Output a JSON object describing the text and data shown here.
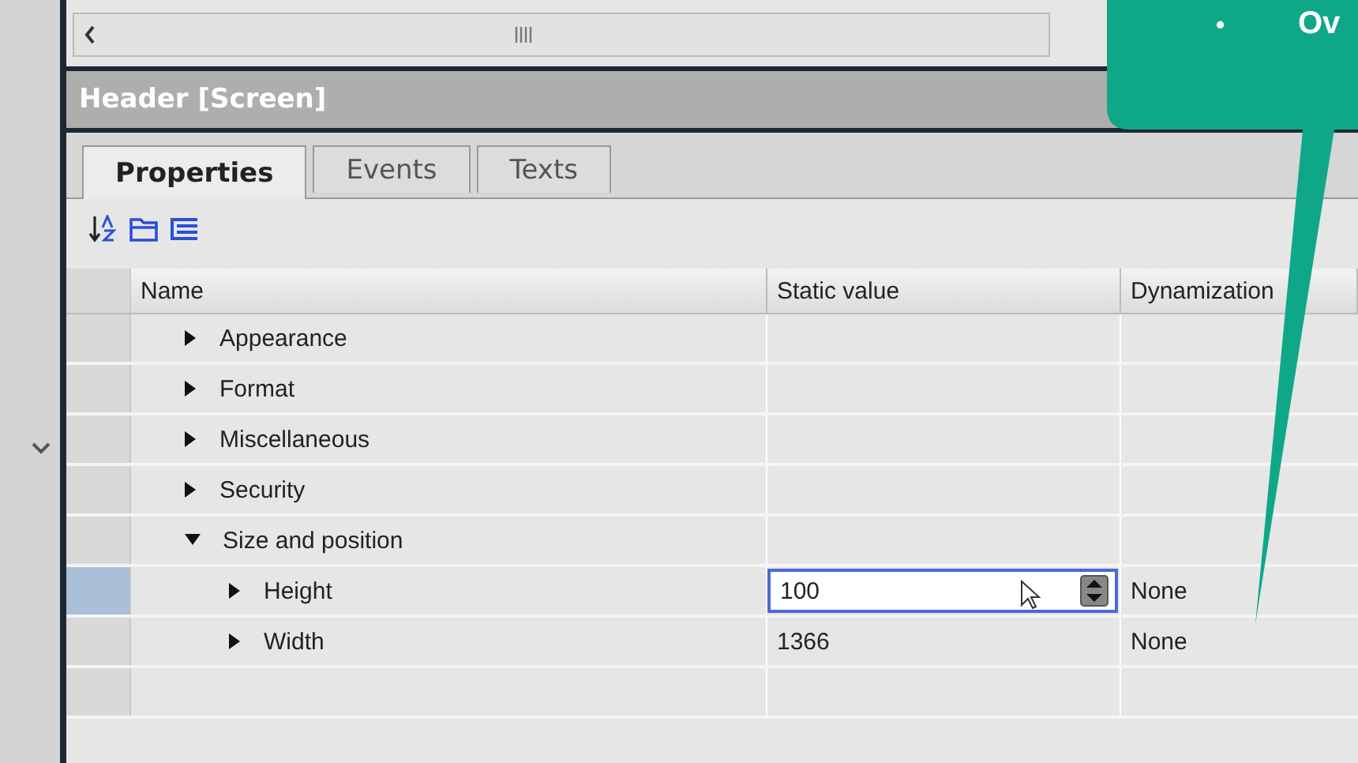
{
  "panel": {
    "title": "Header [Screen]"
  },
  "tabs": [
    {
      "label": "Properties",
      "selected": true
    },
    {
      "label": "Events",
      "selected": false
    },
    {
      "label": "Texts",
      "selected": false
    }
  ],
  "table": {
    "columns": [
      "Name",
      "Static value",
      "Dynamization"
    ],
    "rows": [
      {
        "name": "Appearance",
        "expanded": false,
        "selected": false
      },
      {
        "name": "Format",
        "expanded": false,
        "selected": false
      },
      {
        "name": "Miscellaneous",
        "expanded": false,
        "selected": false
      },
      {
        "name": "Security",
        "expanded": false,
        "selected": false
      },
      {
        "name": "Size and position",
        "expanded": true,
        "selected": false,
        "children": [
          {
            "name": "Height",
            "expanded": false,
            "selected": true,
            "value": "100",
            "editing": true,
            "dynamization": "None"
          },
          {
            "name": "Width",
            "expanded": false,
            "selected": false,
            "value": "1366",
            "editing": false,
            "dynamization": "None"
          }
        ]
      }
    ]
  },
  "callout": {
    "bullet": "•",
    "text": "Ov"
  }
}
